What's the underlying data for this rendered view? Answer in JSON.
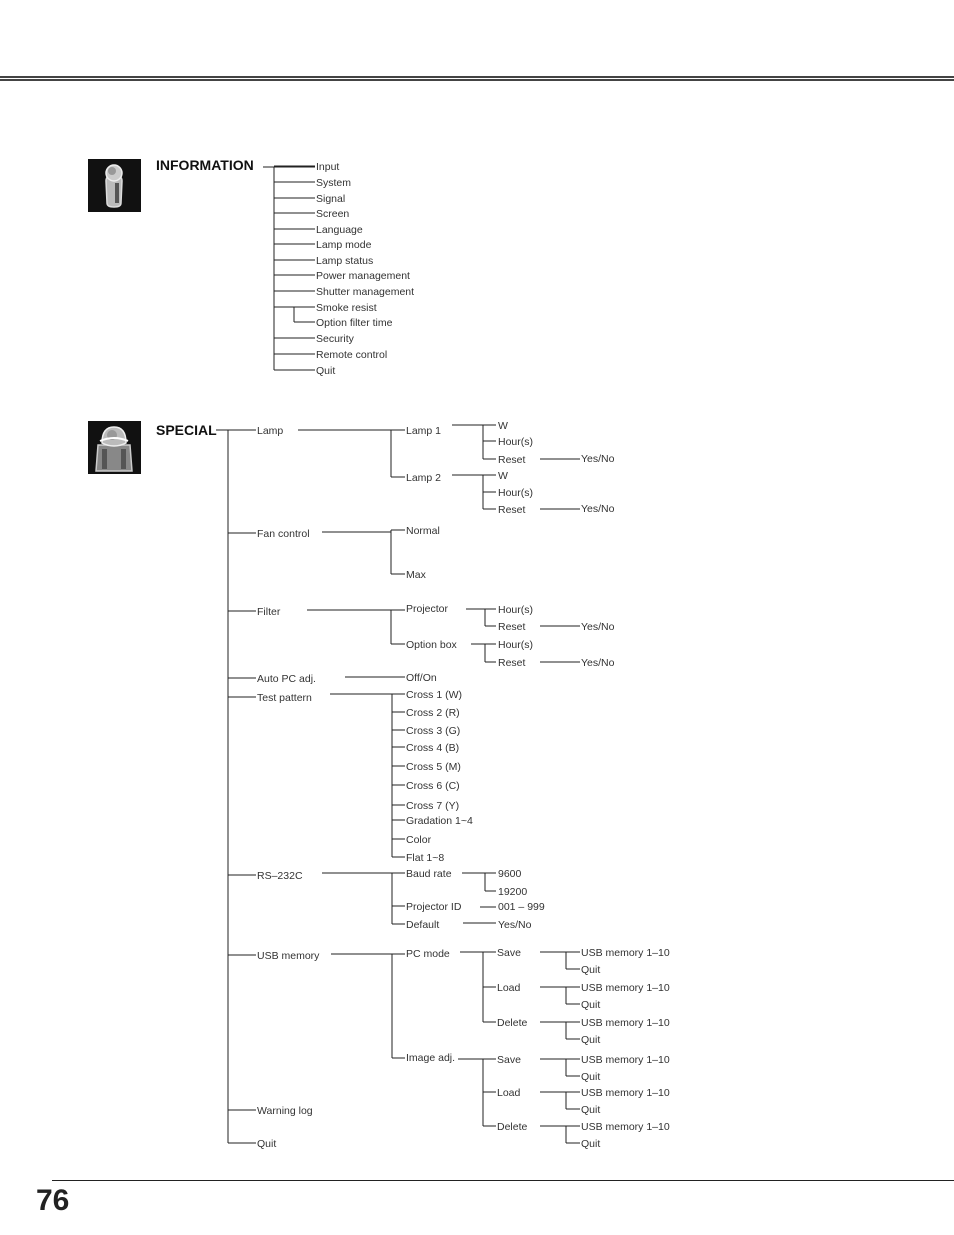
{
  "page_number": "76",
  "information": {
    "title": "INFORMATION",
    "icon": "information-icon",
    "items": [
      "Input",
      "System",
      "Signal",
      "Screen",
      "Language",
      "Lamp mode",
      "Lamp status",
      "Power management",
      "Shutter management",
      "Smoke resist",
      "Option filter time",
      "Security",
      "Remote control",
      "Quit"
    ]
  },
  "special": {
    "title": "SPECIAL",
    "icon": "special-icon",
    "lamp": {
      "label": "Lamp",
      "lamp1": {
        "label": "Lamp 1",
        "items": [
          "W",
          "Hour(s)",
          "Reset"
        ],
        "reset_option": "Yes/No"
      },
      "lamp2": {
        "label": "Lamp 2",
        "items": [
          "W",
          "Hour(s)",
          "Reset"
        ],
        "reset_option": "Yes/No"
      }
    },
    "fan_control": {
      "label": "Fan control",
      "items": [
        "Normal",
        "Max"
      ]
    },
    "filter": {
      "label": "Filter",
      "projector": {
        "label": "Projector",
        "items": [
          "Hour(s)",
          "Reset"
        ],
        "reset_option": "Yes/No"
      },
      "option_box": {
        "label": "Option box",
        "items": [
          "Hour(s)",
          "Reset"
        ],
        "reset_option": "Yes/No"
      }
    },
    "auto_pc_adj": {
      "label": "Auto PC adj.",
      "option": "Off/On"
    },
    "test_pattern": {
      "label": "Test pattern",
      "items": [
        "Cross 1 (W)",
        "Cross 2 (R)",
        "Cross 3 (G)",
        "Cross 4 (B)",
        "Cross 5 (M)",
        "Cross 6 (C)",
        "Cross 7 (Y)",
        "Gradation 1~4",
        "Color",
        "Flat 1~8"
      ]
    },
    "rs232c": {
      "label": "RS–232C",
      "baud_rate": {
        "label": "Baud rate",
        "items": [
          "9600",
          "19200"
        ]
      },
      "projector_id": {
        "label": "Projector ID",
        "option": "001 – 999"
      },
      "default": {
        "label": "Default",
        "option": "Yes/No"
      }
    },
    "usb_memory": {
      "label": "USB memory",
      "pc_mode": {
        "label": "PC mode",
        "actions": [
          {
            "label": "Save",
            "items": [
              "USB memory 1–10",
              "Quit"
            ]
          },
          {
            "label": "Load",
            "items": [
              "USB memory 1–10",
              "Quit"
            ]
          },
          {
            "label": "Delete",
            "items": [
              "USB memory 1–10",
              "Quit"
            ]
          }
        ]
      },
      "image_adj": {
        "label": "Image adj.",
        "actions": [
          {
            "label": "Save",
            "items": [
              "USB memory 1–10",
              "Quit"
            ]
          },
          {
            "label": "Load",
            "items": [
              "USB memory 1–10",
              "Quit"
            ]
          },
          {
            "label": "Delete",
            "items": [
              "USB memory 1–10",
              "Quit"
            ]
          }
        ]
      }
    },
    "warning_log": {
      "label": "Warning log"
    },
    "quit": {
      "label": "Quit"
    }
  }
}
